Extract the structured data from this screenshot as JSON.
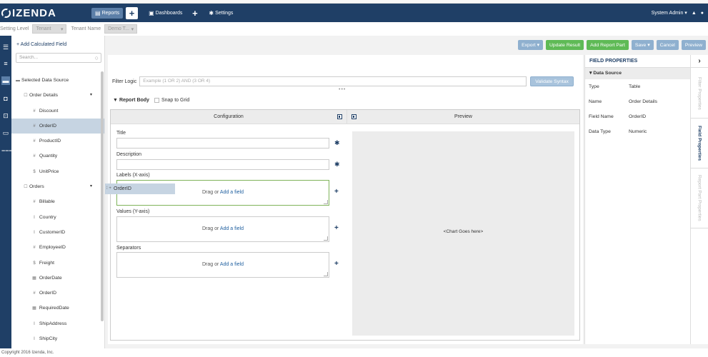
{
  "app": {
    "logo": "IZENDA",
    "nav": [
      {
        "label": "Reports",
        "icon": "report-icon"
      },
      {
        "label": "Dashboards",
        "icon": "dashboard-icon"
      },
      {
        "label": "Settings",
        "icon": "gear-icon"
      }
    ],
    "user": "System Admin ▾",
    "plus": "+"
  },
  "tenant": {
    "setting_level_label": "Setting Level",
    "setting_level_value": "Tenant",
    "tenant_name_label": "Tenant Name",
    "tenant_name_value": "Demo T..."
  },
  "datasource": {
    "add_calc": "Add Calculated Field",
    "search_placeholder": "Search...",
    "root": "Selected Data Source",
    "tables": [
      {
        "name": "Order Details",
        "fields": [
          {
            "icon": "#",
            "name": "Discount"
          },
          {
            "icon": "#",
            "name": "OrderID",
            "selected": true
          },
          {
            "icon": "#",
            "name": "ProductID"
          },
          {
            "icon": "#",
            "name": "Quantity"
          },
          {
            "icon": "$",
            "name": "UnitPrice"
          }
        ]
      },
      {
        "name": "Orders",
        "fields": [
          {
            "icon": "#",
            "name": "Billable"
          },
          {
            "icon": "I",
            "name": "Country"
          },
          {
            "icon": "I",
            "name": "CustomerID"
          },
          {
            "icon": "#",
            "name": "EmployeeID"
          },
          {
            "icon": "$",
            "name": "Freight"
          },
          {
            "icon": "▦",
            "name": "OrderDate"
          },
          {
            "icon": "#",
            "name": "OrderID"
          },
          {
            "icon": "▦",
            "name": "RequiredDate"
          },
          {
            "icon": "I",
            "name": "ShipAddress"
          },
          {
            "icon": "I",
            "name": "ShipCity"
          },
          {
            "icon": "I",
            "name": "ShipName"
          }
        ]
      }
    ]
  },
  "toolbar": {
    "export": "Export ▾",
    "update": "Update Result",
    "add_part": "Add Report Part",
    "save": "Save ▾",
    "cancel": "Cancel",
    "preview": "Preview"
  },
  "filter": {
    "label": "Filter Logic",
    "placeholder": "Example (1 OR 2) AND (3 OR 4)",
    "validate": "Validate Syntax"
  },
  "report_body": {
    "title": "Report Body",
    "snap": "Snap to Grid",
    "config_head": "Configuration",
    "preview_head": "Preview",
    "fields": {
      "title": "Title",
      "description": "Description",
      "labels": "Labels (X-axis)",
      "values": "Values (Y-axis)",
      "separators": "Separators"
    },
    "drag_text": "Drag or ",
    "add_field": "Add a field",
    "drag_chip": "OrderID",
    "chart_placeholder": "<Chart Goes here>"
  },
  "props": {
    "title": "FIELD PROPERTIES",
    "section": "Data Source",
    "rows": [
      {
        "k": "Type",
        "v": "Table"
      },
      {
        "k": "Name",
        "v": "Order Details"
      },
      {
        "k": "Field Name",
        "v": "OrderID"
      },
      {
        "k": "Data Type",
        "v": "Numeric"
      }
    ],
    "tabs": [
      "Filter Properties",
      "Field Properties",
      "Report Part Properties"
    ]
  },
  "footer": "Copyright 2016 Izenda, Inc."
}
